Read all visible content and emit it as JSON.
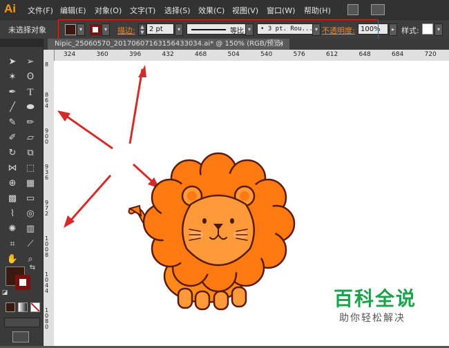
{
  "app": {
    "logo": "Ai"
  },
  "menu": [
    "文件(F)",
    "编辑(E)",
    "对象(O)",
    "文字(T)",
    "选择(S)",
    "效果(C)",
    "视图(V)",
    "窗口(W)",
    "帮助(H)"
  ],
  "control_bar": {
    "selection_status": "未选择对象",
    "stroke_label": "描边:",
    "stroke_weight": "2 pt",
    "stroke_profile": "等比",
    "brush_definition": "• 3 pt. Rou...",
    "opacity_label": "不透明度:",
    "opacity_value": "100%",
    "style_label": "样式:"
  },
  "document_tab": {
    "title": "Nipic_25060570_20170607163156433034.ai* @ 150% (RGB/预览)",
    "close": "×"
  },
  "ruler_top": [
    "324",
    "360",
    "396",
    "432",
    "468",
    "504",
    "540",
    "576",
    "612",
    "648",
    "684",
    "720"
  ],
  "ruler_left": [
    "8",
    "864",
    "900",
    "936",
    "972",
    "1008",
    "1044",
    "1080"
  ],
  "colors": {
    "fill": "#3a1a0e",
    "stroke": "#7a1010",
    "annotation": "#d42a2a",
    "mane": "#ff7a10",
    "face": "#ff9a3a",
    "outline": "#5a1a0a"
  },
  "watermark": {
    "title": "百科全说",
    "subtitle": "助你轻松解决"
  }
}
